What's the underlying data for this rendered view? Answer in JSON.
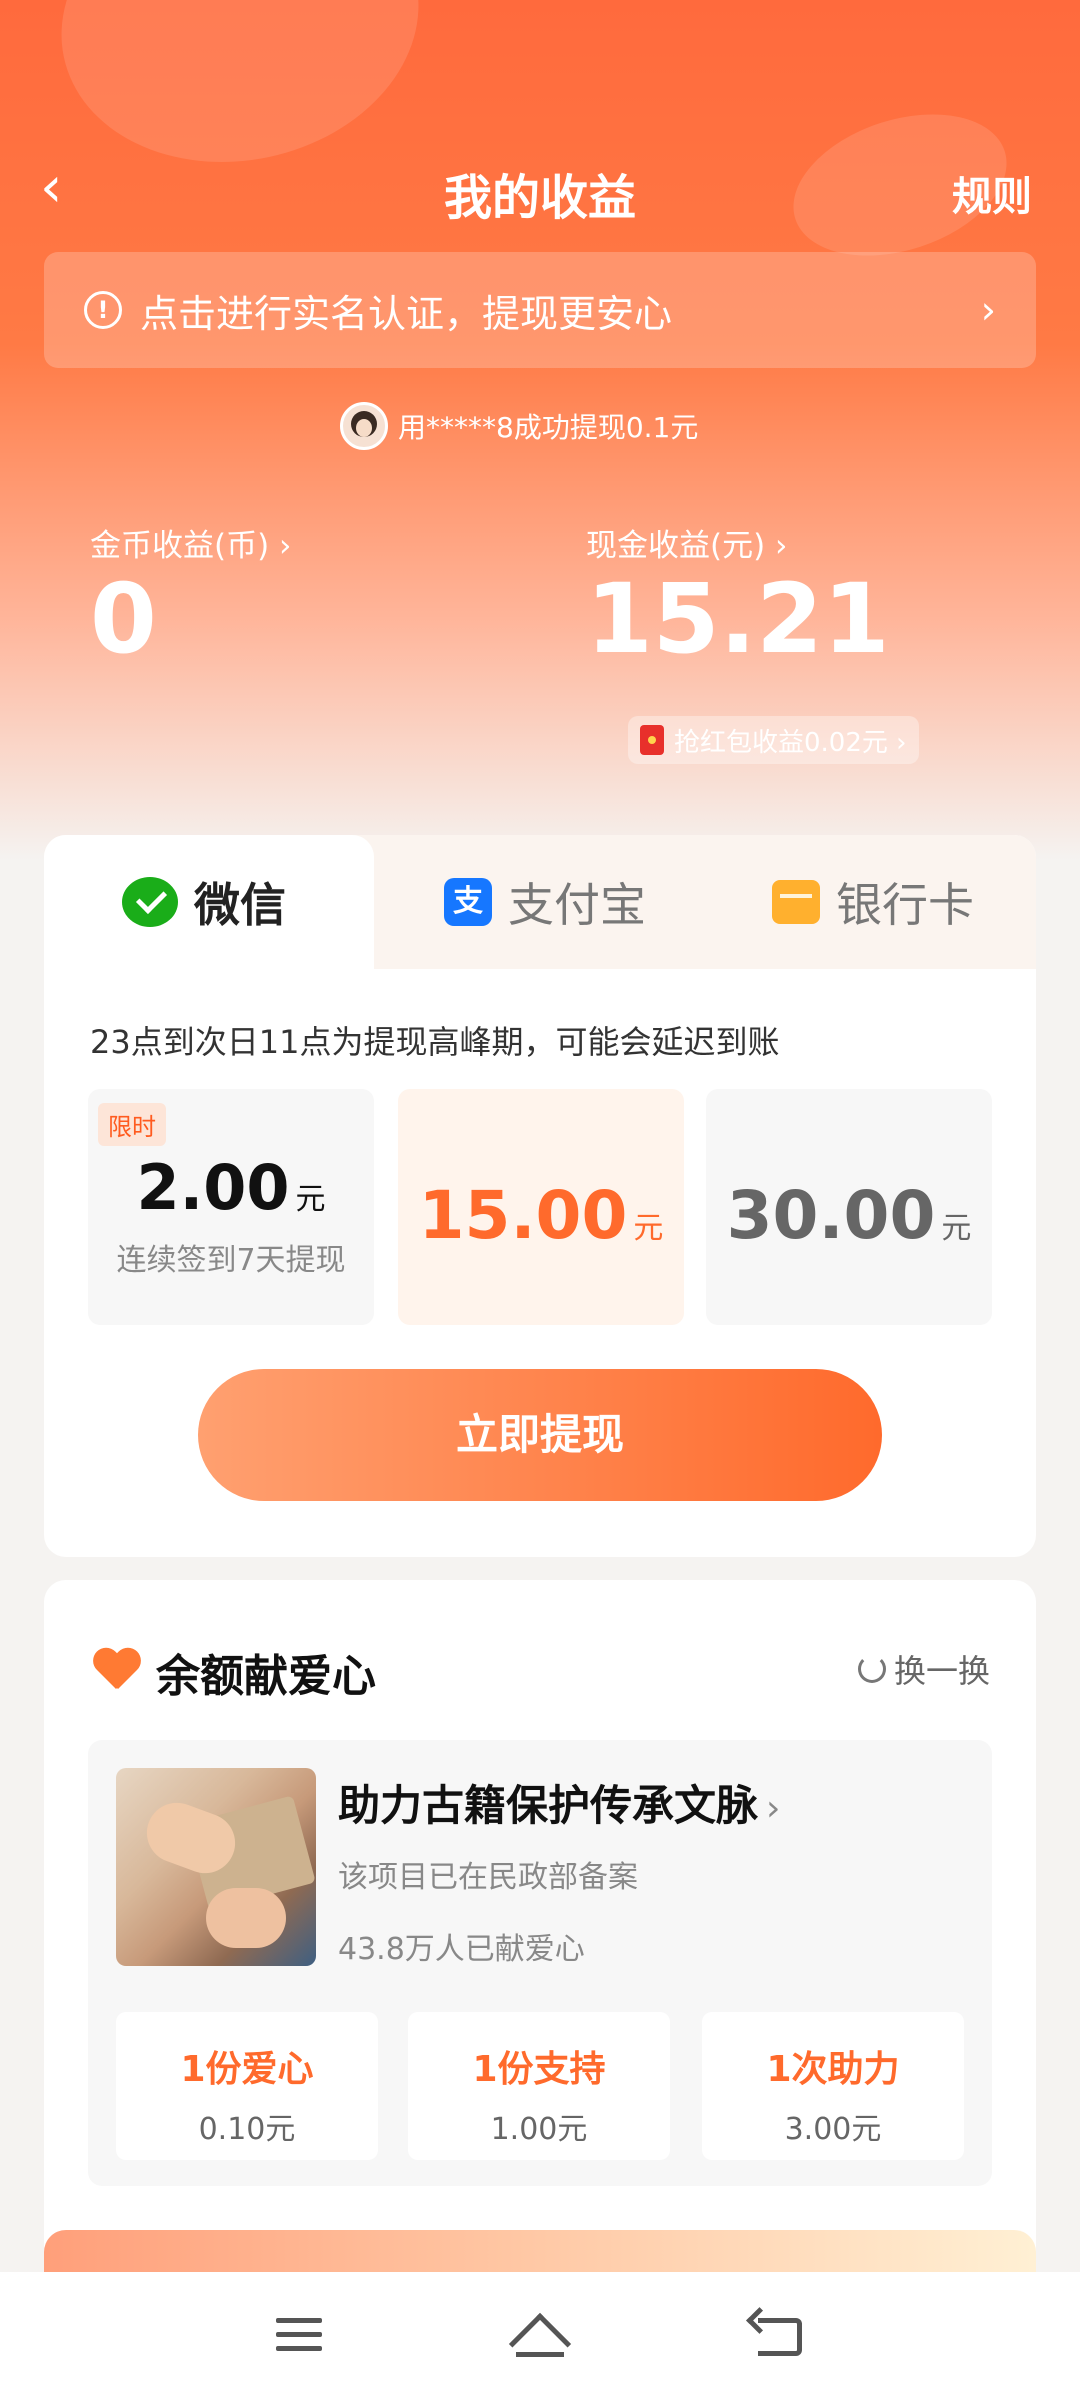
{
  "header": {
    "title": "我的收益",
    "rules": "规则"
  },
  "verify_banner": {
    "text": "点击进行实名认证，提现更安心"
  },
  "ticker": {
    "text": "用*****8成功提现0.1元"
  },
  "stats": {
    "coin_label": "金币收益(币) ›",
    "coin_value": "0",
    "cash_label": "现金收益(元) ›",
    "cash_value": "15.21",
    "redpacket_text": "抢红包收益0.02元 ›"
  },
  "tabs": [
    {
      "label": "微信",
      "icon": "wechat-icon",
      "active": true
    },
    {
      "label": "支付宝",
      "icon": "alipay-icon"
    },
    {
      "label": "银行卡",
      "icon": "bank-card-icon"
    }
  ],
  "withdraw": {
    "notice": "23点到次日11点为提现高峰期，可能会延迟到账",
    "options": [
      {
        "badge": "限时",
        "amount": "2.00",
        "unit": "元",
        "sub": "连续签到7天提现"
      },
      {
        "amount": "15.00",
        "unit": "元",
        "selected": true
      },
      {
        "amount": "30.00",
        "unit": "元"
      }
    ],
    "button": "立即提现"
  },
  "charity": {
    "title": "余额献爱心",
    "refresh": "换一换",
    "project": {
      "title": "助力古籍保护传承文脉",
      "desc1": "该项目已在民政部备案",
      "desc2": "43.8万人已献爱心"
    },
    "donations": [
      {
        "label": "1份爱心",
        "price": "0.10元"
      },
      {
        "label": "1份支持",
        "price": "1.00元"
      },
      {
        "label": "1次助力",
        "price": "3.00元"
      }
    ]
  },
  "colors": {
    "brand": "#ff6a2c",
    "hero": "#ff6a3d",
    "wechat": "#1aad19",
    "alipay": "#1677ff",
    "bank": "#ffb02e"
  }
}
